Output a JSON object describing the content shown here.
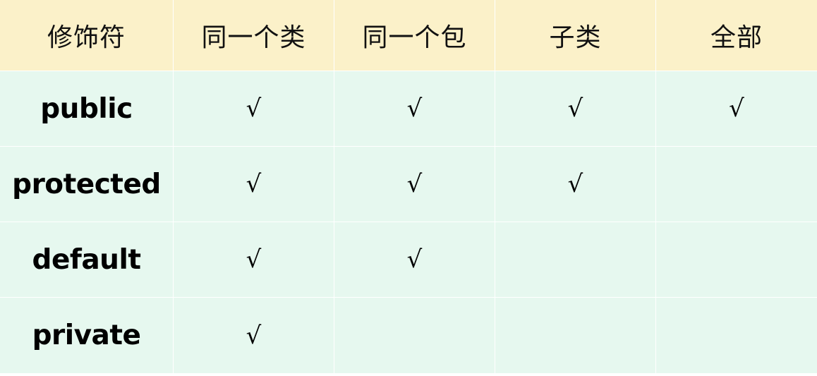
{
  "table": {
    "headers": [
      "修饰符",
      "同一个类",
      "同一个包",
      "子类",
      "全部"
    ],
    "rows": [
      {
        "modifier": "public",
        "cells": [
          "√",
          "√",
          "√",
          "√"
        ]
      },
      {
        "modifier": "protected",
        "cells": [
          "√",
          "√",
          "√",
          ""
        ]
      },
      {
        "modifier": "default",
        "cells": [
          "√",
          "√",
          "",
          ""
        ]
      },
      {
        "modifier": "private",
        "cells": [
          "√",
          "",
          "",
          ""
        ]
      }
    ]
  },
  "colors": {
    "header_bg": "#fbf1c9",
    "body_bg": "#e6f8ef",
    "grid_line": "#ffffff"
  }
}
